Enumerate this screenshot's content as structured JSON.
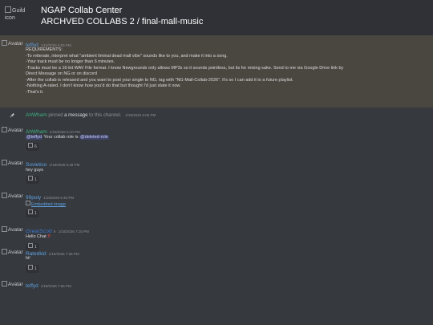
{
  "header": {
    "guild_icon_alt": "Guild icon",
    "title": "NGAP Collab Center",
    "channel_path": "ARCHVED COLLABS 2 / final-mall-music"
  },
  "avatar_alt": "Avatar",
  "pinned_message": {
    "author": "teffyd",
    "timestamp": "1/18/2026 6:05 PM",
    "lines": [
      "REQUIREMENTS:",
      "-To reiterate, interpret what \"ambient liminal dead mall vibe\" sounds like to you, and make it into a song.",
      "-Your track must be no longer than 6 minutes.",
      "-Tracks must be a 16-bit WAV File format. I know Newgrounds only allows MP3s so it sounds pointless, but its for mixing sake. Send to me via Google Drive link by",
      "Direct Message on NG or on discord",
      "-After the collab is released and you want to post your single to NG, tag with \"NG-Mall-Collab-2026\". It's so I can add it to a future playlist.",
      "-Nothing A-rated. I don't know how you'd do that but thought I'd just state it now.",
      "-That's it."
    ]
  },
  "system_message": {
    "actor": "AhWham",
    "verb": "pinned",
    "object": "a message",
    "suffix": "to this channel.",
    "timestamp": "1/18/2026 6:06 PM"
  },
  "messages": [
    {
      "author": "AhWham",
      "timestamp": "1/18/2026 6:10 PM",
      "mention_user": "@teffyd",
      "text_mid": " Your collab role is ",
      "mention_role": "@deleted-role",
      "reaction_count": "6"
    },
    {
      "author": "Sovietico",
      "timestamp": "1/18/2026 6:38 PM",
      "text": "hey guys",
      "reaction_count": "1"
    },
    {
      "author": "99poly",
      "timestamp": "1/18/2026 6:40 PM",
      "link_text": "Embedded image",
      "reaction_count": "1"
    },
    {
      "author": "GreatScott",
      "timestamp": "1/18/2026 7:15 PM",
      "text": "Hello Chat",
      "bangs": "!!",
      "reaction_count": "1"
    },
    {
      "author": "Ratedkid",
      "timestamp": "1/18/2026 7:36 PM",
      "text": "hi!",
      "reaction_count": "1"
    },
    {
      "author": "teffyd",
      "timestamp": "1/18/2026 7:56 PM"
    }
  ]
}
